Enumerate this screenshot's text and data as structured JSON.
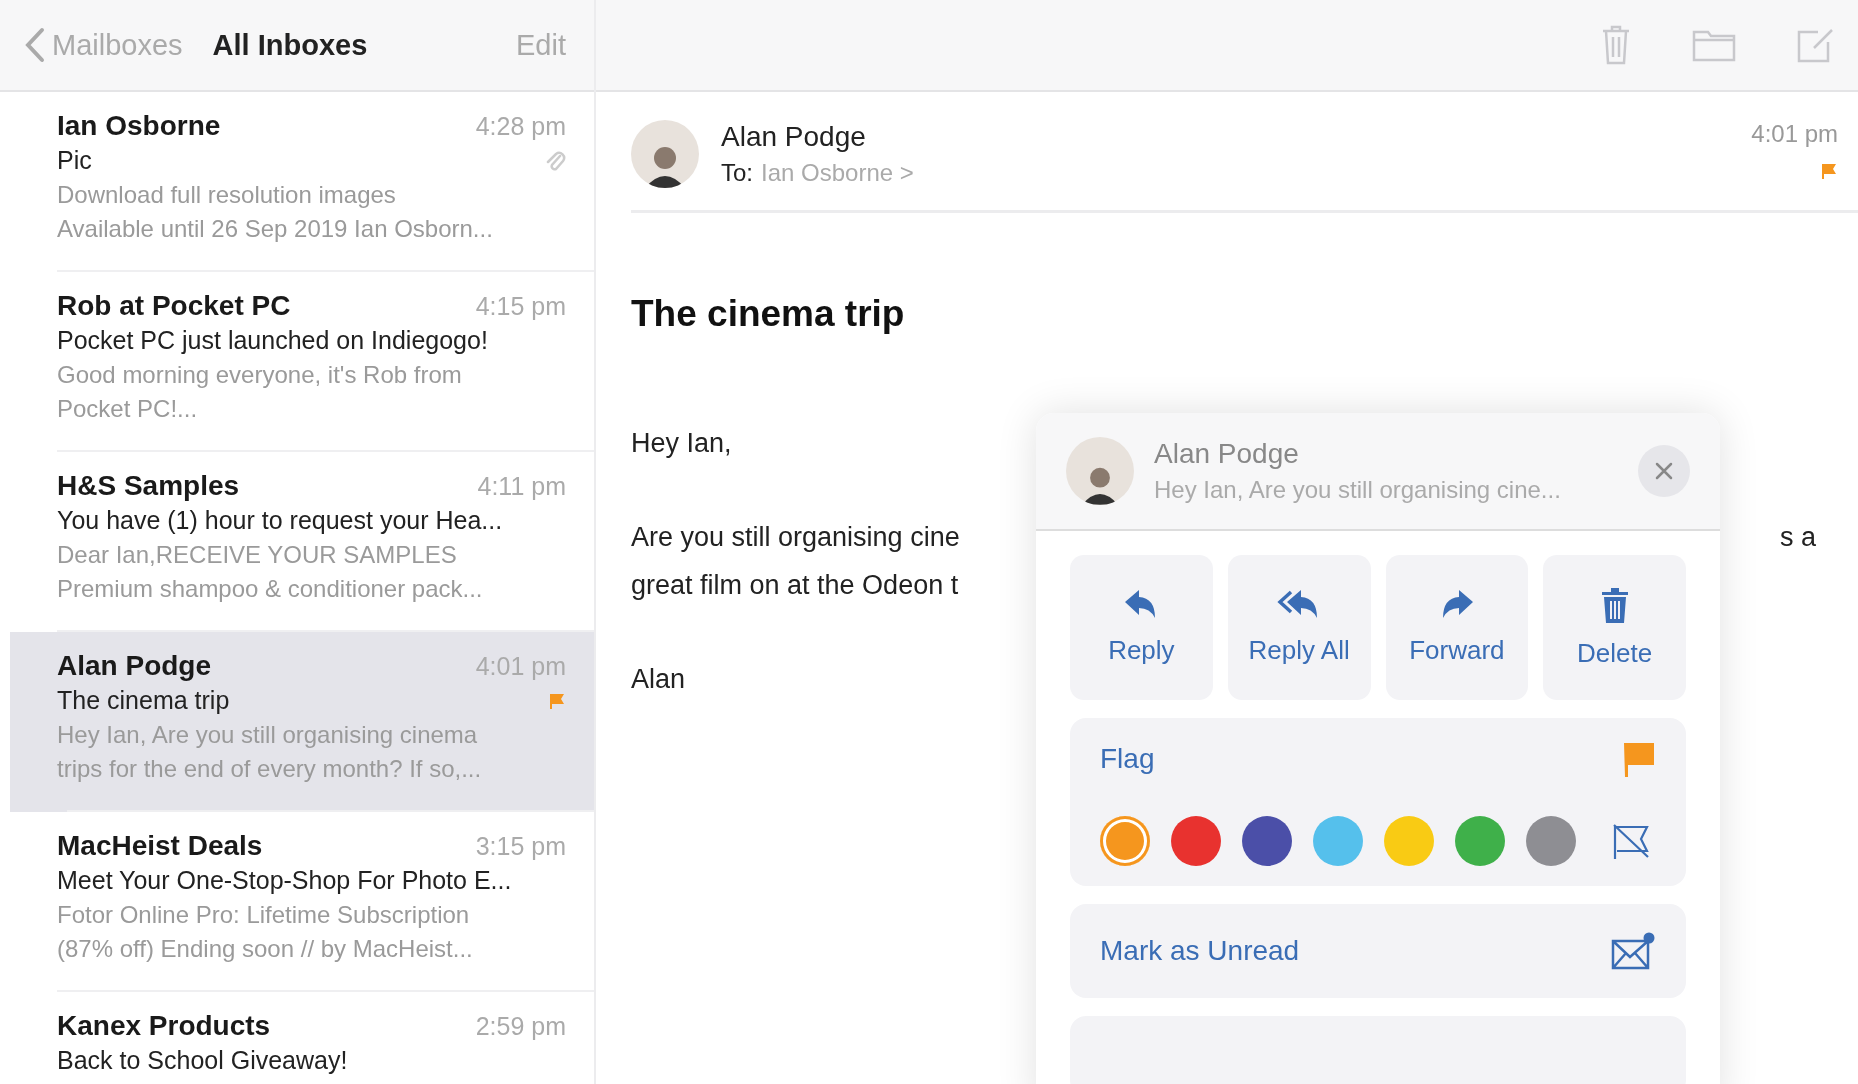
{
  "sidebar": {
    "back_label": "Mailboxes",
    "title": "All Inboxes",
    "edit_label": "Edit"
  },
  "messages": [
    {
      "sender": "Ian Osborne",
      "time": "4:28 pm",
      "subject": "Pic",
      "preview_lines": [
        "Download full resolution images",
        "Available until 26 Sep 2019 Ian Osborn..."
      ],
      "attachment": true,
      "flagged": false,
      "selected": false
    },
    {
      "sender": "Rob at Pocket PC",
      "time": "4:15 pm",
      "subject": "Pocket PC just launched on Indiegogo!",
      "preview_lines": [
        "Good morning everyone, it's Rob from",
        "Pocket PC!..."
      ],
      "attachment": false,
      "flagged": false,
      "selected": false
    },
    {
      "sender": "H&S Samples",
      "time": "4:11 pm",
      "subject": "You have (1) hour to request your Hea...",
      "preview_lines": [
        "Dear Ian,RECEIVE YOUR SAMPLES",
        "Premium shampoo & conditioner pack..."
      ],
      "attachment": false,
      "flagged": false,
      "selected": false
    },
    {
      "sender": "Alan Podge",
      "time": "4:01 pm",
      "subject": "The cinema trip",
      "preview_lines": [
        "Hey Ian, Are you still organising cinema",
        "trips for the end of every month? If so,..."
      ],
      "attachment": false,
      "flagged": true,
      "selected": true
    },
    {
      "sender": "MacHeist Deals",
      "time": "3:15 pm",
      "subject": "Meet Your One-Stop-Shop For Photo E...",
      "preview_lines": [
        "Fotor Online Pro: Lifetime Subscription",
        "(87% off) Ending soon // by MacHeist..."
      ],
      "attachment": false,
      "flagged": false,
      "selected": false
    },
    {
      "sender": "Kanex Products",
      "time": "2:59 pm",
      "subject": "Back to School Giveaway!",
      "attachment": false,
      "flagged": false,
      "selected": false
    }
  ],
  "message": {
    "sender": "Alan Podge",
    "to_label": "To:",
    "to": "Ian Osborne",
    "to_chevron": ">",
    "time": "4:01 pm",
    "flagged": true,
    "subject": "The cinema trip",
    "body": [
      {
        "lines": [
          {
            "left": "Hey Ian,"
          }
        ]
      },
      {
        "lines": [
          {
            "left": "Are you still organising cine",
            "right": "s a"
          },
          {
            "left": "great film on at the Odeon t"
          }
        ]
      },
      {
        "lines": [
          {
            "left": "Alan"
          }
        ]
      }
    ]
  },
  "popover": {
    "sender": "Alan Podge",
    "preview": "Hey Ian, Are you still organising cine...",
    "actions": [
      {
        "kind": "reply",
        "label": "Reply"
      },
      {
        "kind": "reply-all",
        "label": "Reply All"
      },
      {
        "kind": "forward",
        "label": "Forward"
      },
      {
        "kind": "delete",
        "label": "Delete"
      }
    ],
    "flag_label": "Flag",
    "flag_colors": [
      {
        "color": "#f5961e",
        "selected": true
      },
      {
        "color": "#e8322f",
        "selected": false
      },
      {
        "color": "#4b4fa8",
        "selected": false
      },
      {
        "color": "#55c0ec",
        "selected": false
      },
      {
        "color": "#f9cb14",
        "selected": false
      },
      {
        "color": "#3fb04a",
        "selected": false
      },
      {
        "color": "#8e8e93",
        "selected": false
      }
    ],
    "mark_label": "Mark as Unread"
  }
}
